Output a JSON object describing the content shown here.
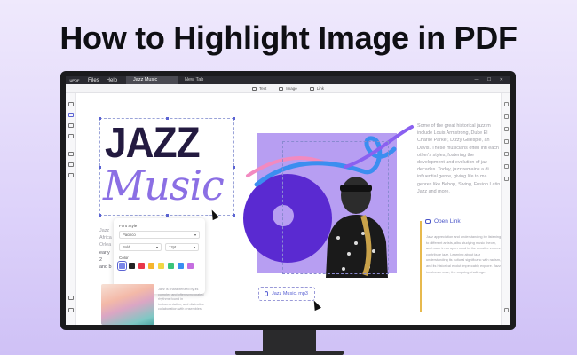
{
  "headline": "How to Highlight Image in PDF",
  "titlebar": {
    "logo": "UPDF",
    "menus": [
      "Files",
      "Help"
    ],
    "tabs": [
      "Jazz Music",
      "New Tab"
    ]
  },
  "toolbar": {
    "tools": [
      "Text",
      "Image",
      "Link"
    ]
  },
  "document": {
    "heading_line1": "JAZZ",
    "heading_line2": "Music",
    "right_column_text": "Some of the great historical jazz m include Louis Armstrong, Duke El Charlie Parker, Dizzy Gillespie, an Davis. These musicians often infl each other's styles, fostering the development and evolution of jaz decades. Today, jazz remains a di influential genre, giving life to ma genres like Bebop, Swing, Fusion Latin Jazz and more.",
    "left_fragments": [
      "Jazz",
      "Africa",
      "Orlea",
      "early 2",
      "and b"
    ],
    "open_link": "Open Link",
    "quote_text": "Jazz appreciation and understanding by listening to different artists, albu studying music theory, and more in an open mind to the creative expres contribute jazz. Learning about jazz understanding its cultural significanc with racism, and its historical evolut impeccably explore. Jazz involves n core, the ongoing challenge.",
    "caption_text": "Jazz is characterized by its complex and often syncopated rhythms found in instrumentation, and distinctive collaboration with ensembles.",
    "audio_file": "Jazz Music. mp3"
  },
  "font_panel": {
    "title": "Font Style",
    "font_family": "Pacifico",
    "weight": "Bold",
    "size": "12pt",
    "color_label": "Color",
    "swatches": [
      "#7a86e8",
      "#222222",
      "#e8374a",
      "#f5b52e",
      "#f1d645",
      "#3bc47a",
      "#3a8ef0",
      "#c56ee0"
    ],
    "selected_swatch_index": 0
  },
  "colors": {
    "accent": "#5b63d3",
    "music_purple": "#8b6fe4",
    "art_background": "#b79ef2",
    "disc": "#5a2ad1"
  }
}
